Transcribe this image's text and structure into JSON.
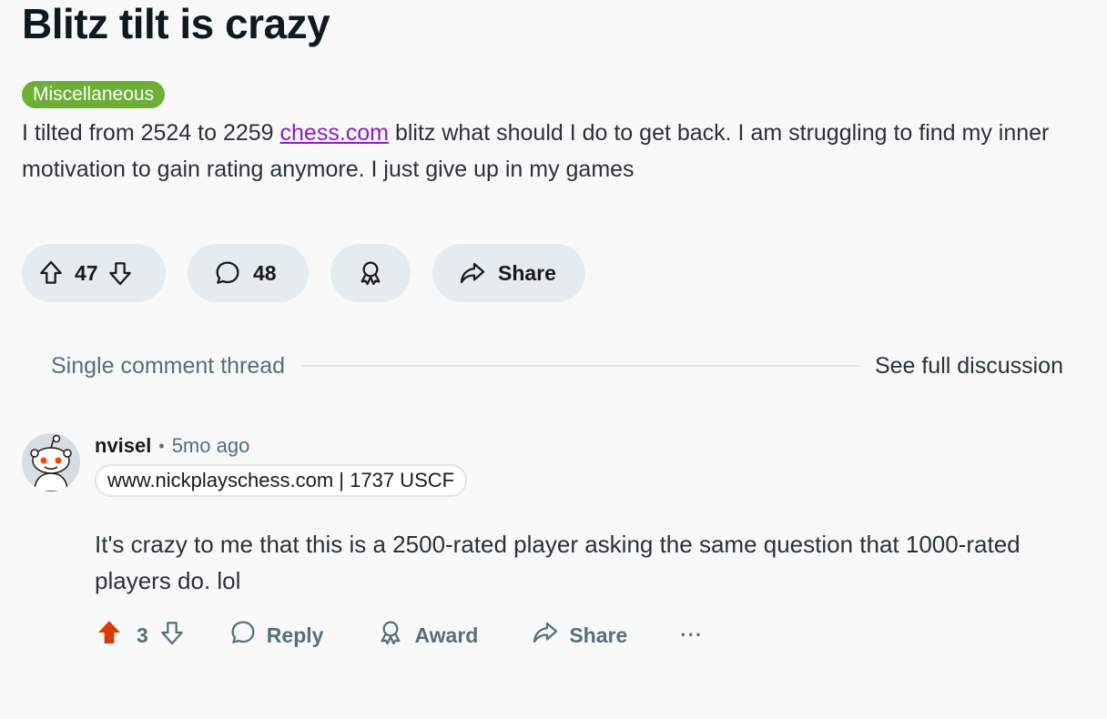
{
  "post": {
    "title": "Blitz tilt is crazy",
    "flair": "Miscellaneous",
    "flair_color": "#6bb034",
    "body_before_link": "I tilted from 2524 to 2259 ",
    "body_link": "chess.com",
    "body_after_link": " blitz what should I do to get back. I am struggling to find my inner motivation to gain rating anymore. I just give up in my games",
    "votes": "47",
    "comments": "48",
    "share_label": "Share",
    "icons": [
      "upvote-icon",
      "downvote-icon",
      "comment-icon",
      "award-icon",
      "share-icon"
    ]
  },
  "thread": {
    "label": "Single comment thread",
    "see_full": "See full discussion"
  },
  "comment": {
    "author": "nvisel",
    "separator": "•",
    "time": "5mo ago",
    "user_flair": "www.nickplayschess.com | 1737 USCF",
    "text": "It's crazy to me that this is a 2500-rated player asking the same question that 1000-rated players do. lol",
    "votes": "3",
    "upvoted_color": "#d93a00",
    "reply_label": "Reply",
    "award_label": "Award",
    "share_label": "Share",
    "more_label": "···",
    "icons": [
      "upvote-filled-icon",
      "downvote-icon",
      "reply-icon",
      "award-icon",
      "share-icon",
      "more-icon",
      "snoo-avatar-icon"
    ]
  }
}
